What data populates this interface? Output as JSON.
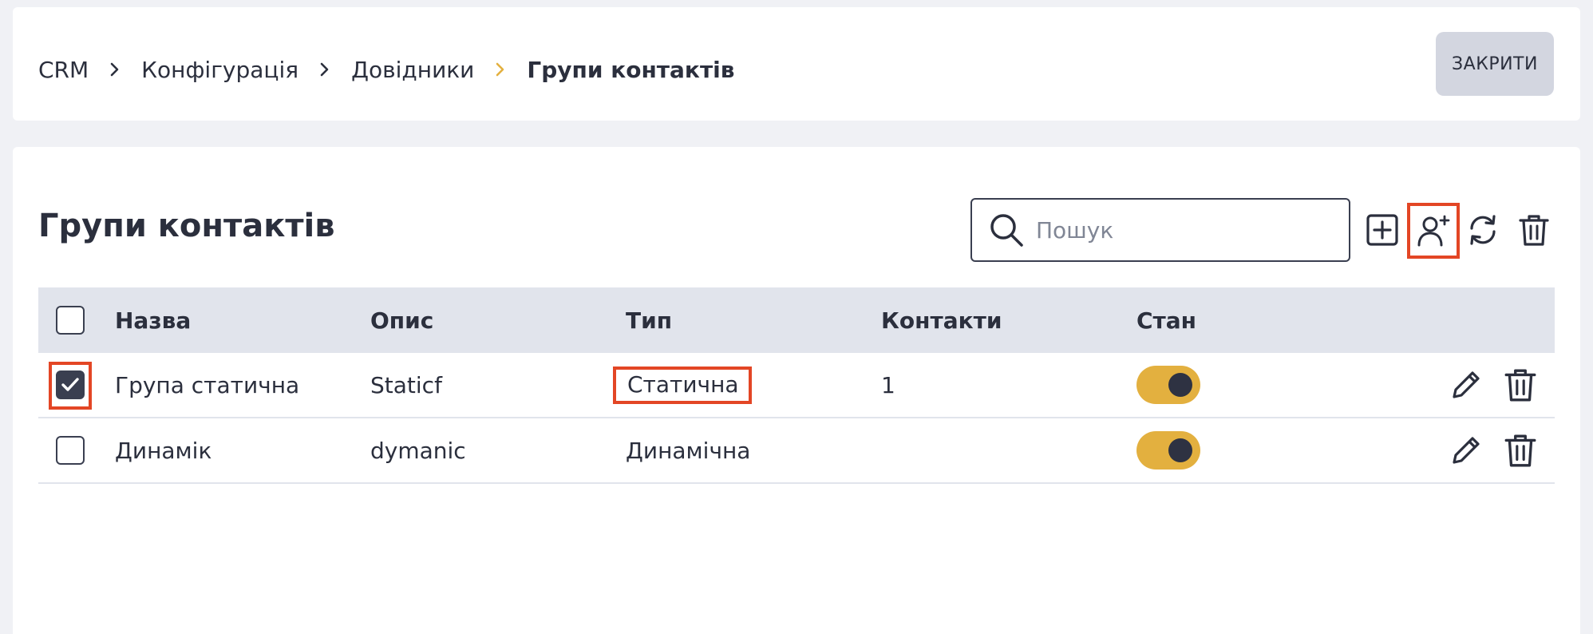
{
  "breadcrumb": {
    "items": [
      "CRM",
      "Конфігурація",
      "Довідники"
    ],
    "current": "Групи контактів"
  },
  "header": {
    "close_label": "ЗАКРИТИ"
  },
  "panel": {
    "title": "Групи контактів",
    "search": {
      "placeholder": "Пошук",
      "value": ""
    }
  },
  "table": {
    "columns": [
      "Назва",
      "Опис",
      "Тип",
      "Контакти",
      "Стан"
    ],
    "rows": [
      {
        "checked": true,
        "name": "Група статична",
        "description": "Staticf",
        "type": "Статична",
        "contacts": "1",
        "active": true
      },
      {
        "checked": false,
        "name": "Динамік",
        "description": "dymanic",
        "type": "Динамічна",
        "contacts": "",
        "active": true
      }
    ]
  },
  "colors": {
    "accent": "#e3b03f",
    "highlight": "#e34625",
    "dark": "#2b2f3d",
    "header_bg": "#e1e4ec"
  },
  "icons": [
    "chevron-right-icon",
    "search-icon",
    "add-square-icon",
    "add-user-icon",
    "refresh-icon",
    "trash-icon",
    "edit-icon",
    "check-icon"
  ]
}
